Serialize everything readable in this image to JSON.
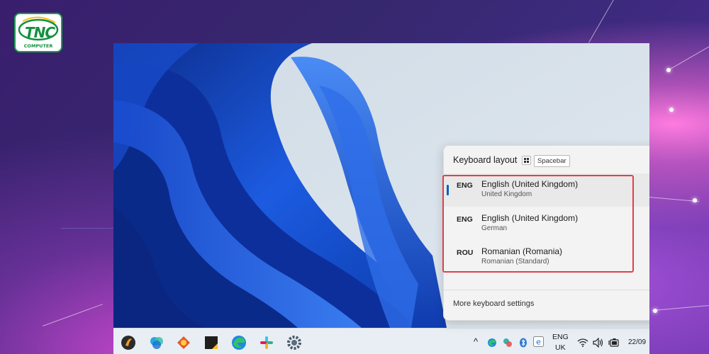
{
  "logo": {
    "brand": "TNC",
    "sub": "COMPUTER"
  },
  "flyout": {
    "title": "Keyboard layout",
    "shortcut_icon": "windows-key-icon",
    "shortcut_key": "Spacebar",
    "layouts": [
      {
        "code": "ENG",
        "name": "English (United Kingdom)",
        "keyboard": "United Kingdom",
        "selected": true
      },
      {
        "code": "ENG",
        "name": "English (United Kingdom)",
        "keyboard": "German",
        "selected": false
      },
      {
        "code": "ROU",
        "name": "Romanian (Romania)",
        "keyboard": "Romanian (Standard)",
        "selected": false
      }
    ],
    "more_settings": "More keyboard settings"
  },
  "taskbar": {
    "apps": [
      "fl-studio-icon",
      "photos-icon",
      "game-icon",
      "sticky-notes-icon",
      "edge-icon",
      "slack-icon",
      "settings-icon"
    ],
    "tray": {
      "chevron": "^",
      "language_top": "ENG",
      "language_bottom": "UK",
      "date": "22/09"
    }
  },
  "colors": {
    "highlight": "#e0404a",
    "accent": "#0a5fc4",
    "brand_green": "#12913f"
  }
}
